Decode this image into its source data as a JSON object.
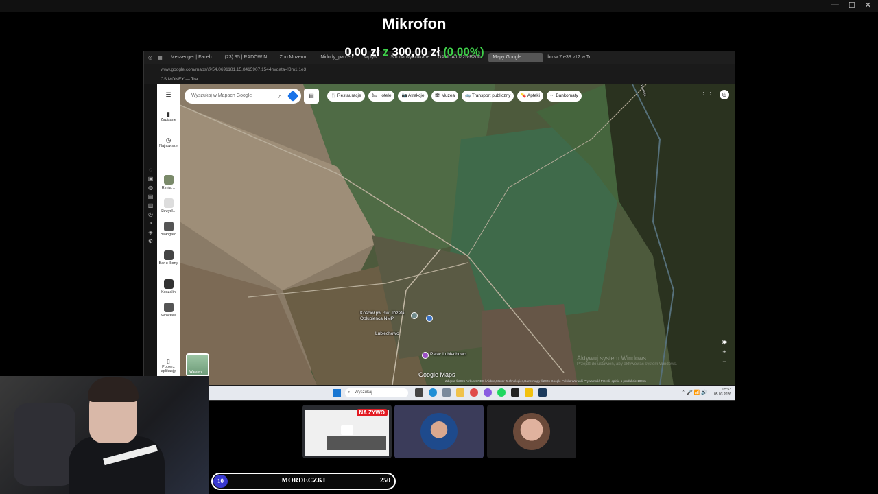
{
  "overlay": {
    "title": "Mikrofon",
    "money_current": "0,00 zł",
    "money_z": "z",
    "money_goal": "300,00 zł",
    "money_pct": "(0.00%)"
  },
  "window_controls": [
    "—",
    "☐",
    "✕"
  ],
  "browser": {
    "tabs": [
      {
        "label": "Messenger | Faceb…"
      },
      {
        "label": "(23) 95 | RADÓW N…"
      },
      {
        "label": "Zoo Muzeum…"
      },
      {
        "label": "Nidody_parcel…"
      },
      {
        "label": "wpływ…"
      },
      {
        "label": "Strona wyszukane"
      },
      {
        "label": "DAHUA LM25-B200…"
      },
      {
        "label": "Mapy Google"
      },
      {
        "label": "bmw 7 e38 v12 w Tr…"
      }
    ],
    "url": "www.google.com/maps/@54.0691181,15.8415907,1544m/data=!3m1!1e3",
    "bookmark": "CS.MONEY — Tra…"
  },
  "maps": {
    "sidebar": [
      {
        "label": "Zapisane",
        "icon": "bookmark-icon"
      },
      {
        "label": "Najnowsze",
        "icon": "history-icon"
      },
      {
        "label": "Rynia…",
        "icon": "place-thumb"
      },
      {
        "label": "Skrzydl…",
        "icon": "place-thumb"
      },
      {
        "label": "Białogard",
        "icon": "place-thumb"
      },
      {
        "label": "Bar u Ikony",
        "icon": "place-thumb"
      },
      {
        "label": "Koszalin",
        "icon": "place-thumb"
      },
      {
        "label": "Wrocław",
        "icon": "place-thumb"
      },
      {
        "label": "Pobierz aplikację",
        "icon": "phone-icon"
      }
    ],
    "search_placeholder": "Wyszukaj w Mapach Google",
    "chips": [
      {
        "label": "Restauracje",
        "icon": "🍴"
      },
      {
        "label": "Hotele",
        "icon": "🛏"
      },
      {
        "label": "Atrakcje",
        "icon": "📷"
      },
      {
        "label": "Muzea",
        "icon": "🏛"
      },
      {
        "label": "Transport publiczny",
        "icon": "🚌"
      },
      {
        "label": "Apteki",
        "icon": "💊"
      },
      {
        "label": "Bankomaty",
        "icon": "···"
      }
    ],
    "places": {
      "church": "Kościół pw. św. Józefa Oblubieńca NMP",
      "village": "Lubiechowo",
      "palace": "Pałac Lubiechowo",
      "river": "Parsęta"
    },
    "layers_label": "Warstwy",
    "logo": "Google Maps",
    "watermark": "Aktywuj system Windows",
    "watermark_sub": "Przejdź do ustawień, aby aktywować system Windows.",
    "footer": "Zdjęcia ©2026 Airbus,CNES / Airbus,Maxar Technologies,Dane mapy ©2026 Google   Polska   Warunki   Prywatność   Prześlij opinię o produkcie   100 m"
  },
  "taskbar": {
    "search": "Wyszukaj",
    "time": "05:53",
    "date": "05.03.2026"
  },
  "stream": {
    "live_badge": "NA ŻYWO"
  },
  "bar": {
    "left": "10",
    "label": "MORDECZKI",
    "right": "250",
    "accent": "#3a3ad0"
  }
}
